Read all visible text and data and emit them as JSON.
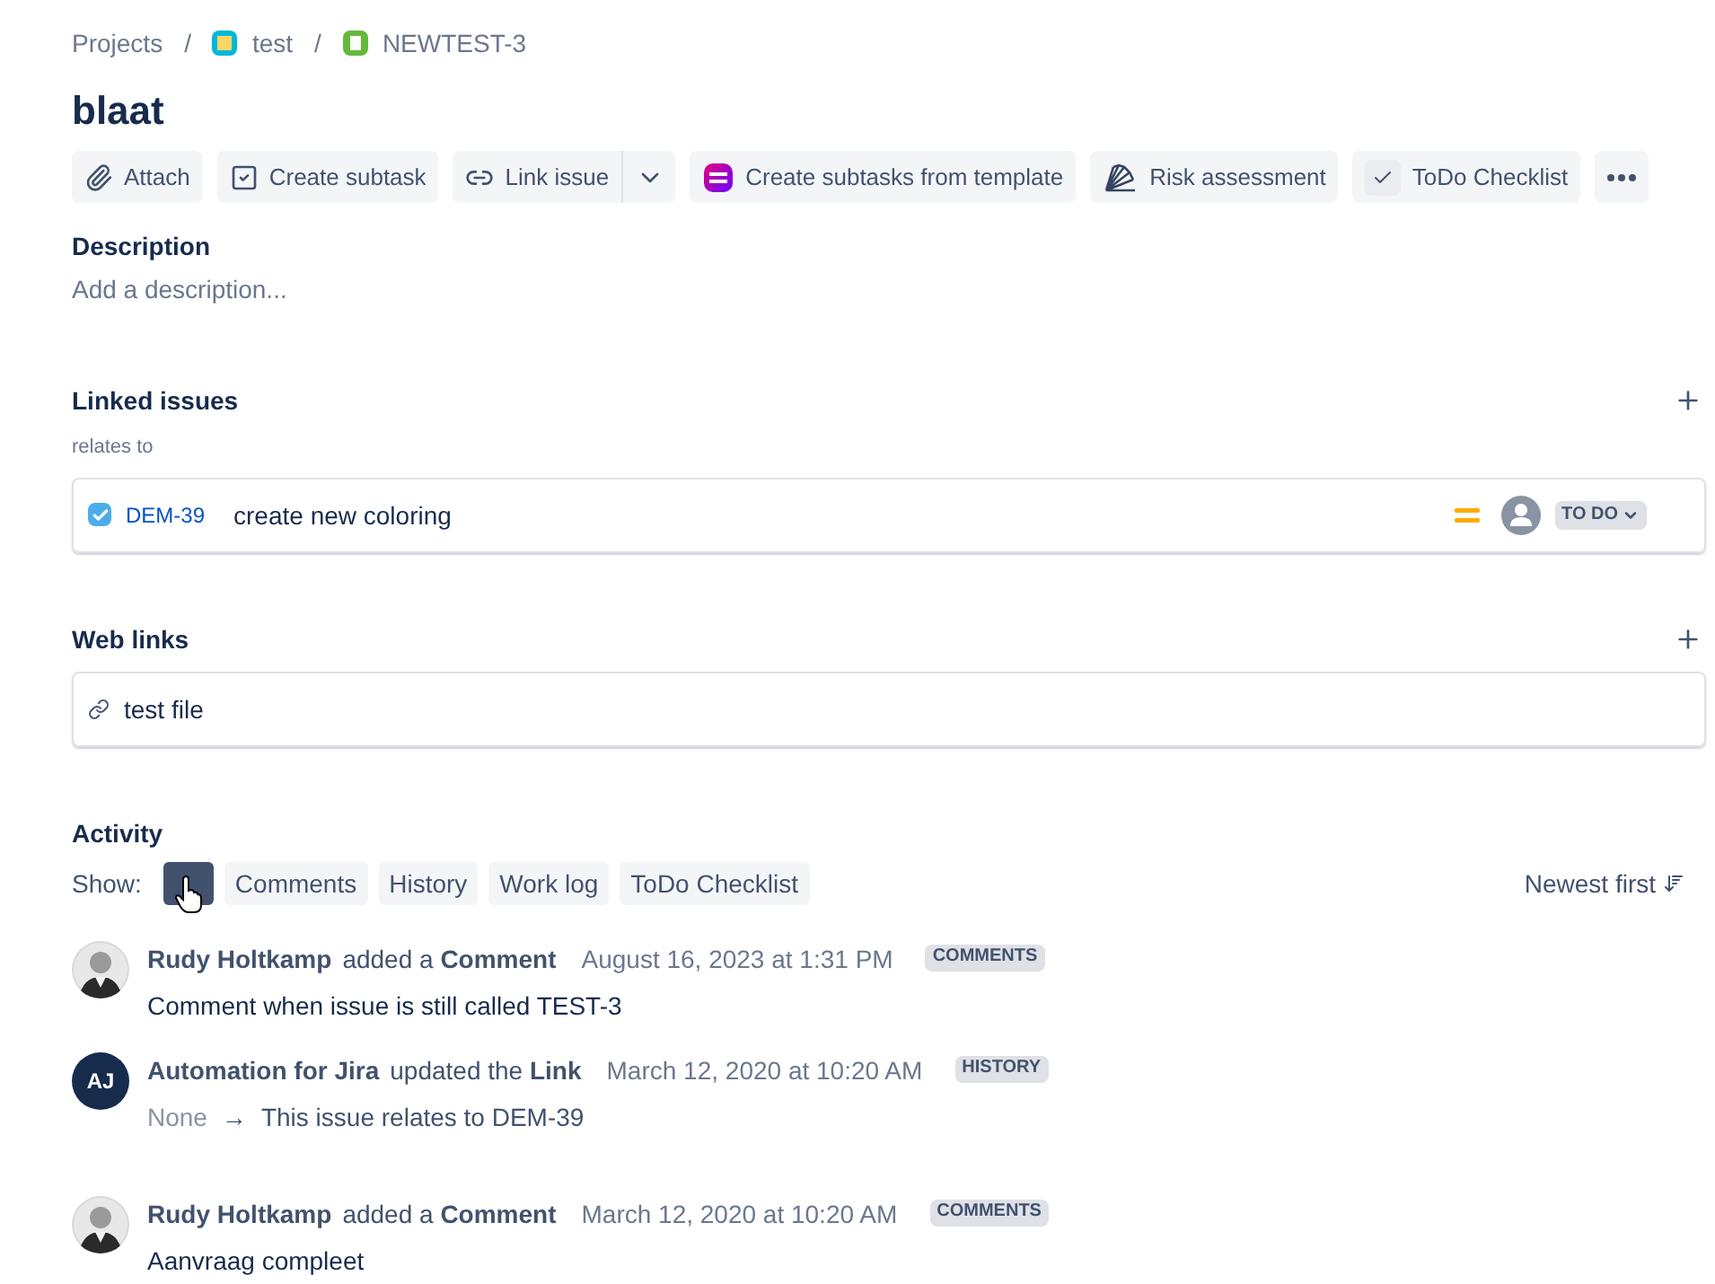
{
  "breadcrumbs": [
    {
      "label": "Projects"
    },
    {
      "label": "test"
    },
    {
      "label": "NEWTEST-3"
    }
  ],
  "breadcrumb_separator": "/",
  "title": "blaat",
  "toolbar": [
    {
      "label": "Attach",
      "dropdown": false
    },
    {
      "label": "Create subtask",
      "dropdown": false
    },
    {
      "label": "Link issue",
      "dropdown": true
    },
    {
      "label": "Create subtasks from template",
      "dropdown": false
    },
    {
      "label": "Risk assessment",
      "dropdown": false
    },
    {
      "label": "ToDo Checklist",
      "dropdown": false
    }
  ],
  "more_button": true,
  "description": {
    "heading": "Description",
    "placeholder": "Add a description..."
  },
  "linked_issues": {
    "heading": "Linked issues",
    "relation": "relates to",
    "items": [
      {
        "key": "DEM-39",
        "summary": "create new coloring",
        "status": "TO DO",
        "done": true
      }
    ]
  },
  "web_links": {
    "heading": "Web links",
    "items": [
      {
        "label": "test file"
      }
    ]
  },
  "activity": {
    "heading": "Activity",
    "show_label": "Show:",
    "sort": "Newest first",
    "filters": [
      {
        "selected": true
      },
      {
        "label": "Comments",
        "selected": false
      },
      {
        "label": "History",
        "selected": false
      },
      {
        "label": "Work log",
        "selected": false
      },
      {
        "label": "ToDo Checklist",
        "selected": false
      }
    ],
    "entries": [
      {
        "kind": "comment",
        "author": "Rudy Holtkamp",
        "action": "added a **Comment**",
        "date": "August 16, 2023 at 1:31 PM",
        "badge": "COMMENTS",
        "body": "Comment when issue is still called TEST-3"
      },
      {
        "kind": "history",
        "author": "Automation for Jira",
        "initials": "AJ",
        "action": "updated the **Link**",
        "date": "March 12, 2020 at 10:20 AM",
        "badge": "HISTORY",
        "from": "None",
        "arrow": "→",
        "to": "This issue relates to DEM-39"
      },
      {
        "kind": "comment",
        "author": "Rudy Holtkamp",
        "action": "added a **Comment**",
        "date": "March 12, 2020 at 10:20 AM",
        "badge": "COMMENTS",
        "body": "Aanvraag compleet"
      }
    ]
  }
}
